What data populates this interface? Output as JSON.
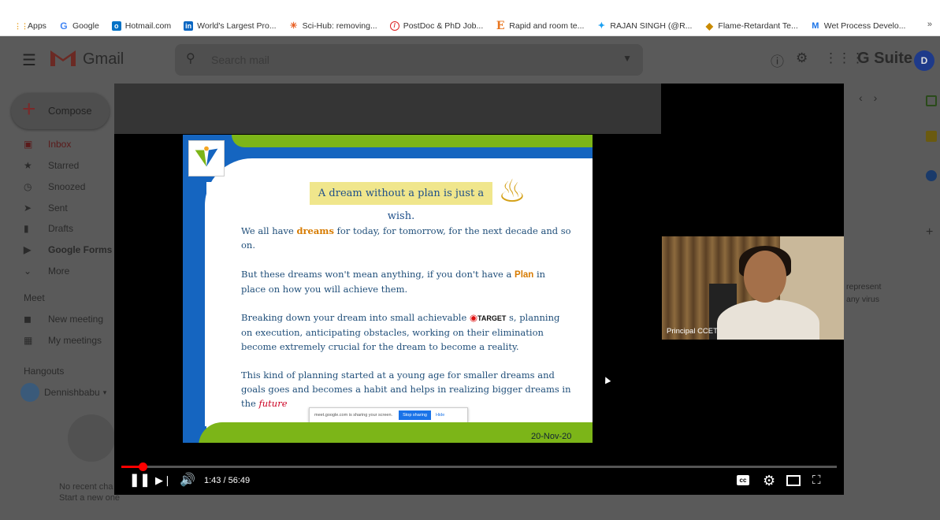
{
  "bookmarks": {
    "items": [
      {
        "label": "Apps",
        "icon": "apps-grid-icon",
        "color": "#e8a020"
      },
      {
        "label": "Google",
        "icon": "google-icon",
        "color": "#4285f4"
      },
      {
        "label": "Hotmail.com",
        "icon": "outlook-icon",
        "color": "#0072c6"
      },
      {
        "label": "World's Largest Pro...",
        "icon": "linkedin-icon",
        "color": "#0a66c2"
      },
      {
        "label": "Sci-Hub: removing...",
        "icon": "scihub-icon",
        "color": "#e85d20"
      },
      {
        "label": "PostDoc & PhD Job...",
        "icon": "compass-icon",
        "color": "#d22"
      },
      {
        "label": "Rapid and room te...",
        "icon": "elsevier-icon",
        "color": "#e87722"
      },
      {
        "label": "RAJAN SINGH (@R...",
        "icon": "twitter-icon",
        "color": "#1da1f2"
      },
      {
        "label": "Flame-Retardant Te...",
        "icon": "diamond-icon",
        "color": "#c98a00"
      },
      {
        "label": "Wet Process Develo...",
        "icon": "w-icon",
        "color": "#1a73e8"
      }
    ],
    "more": "»"
  },
  "gmail": {
    "logo_text": "Gmail",
    "search_placeholder": "Search mail",
    "brand": "G Suite",
    "avatar_letter": "D",
    "compose_label": "Compose",
    "nav": [
      {
        "label": "Inbox",
        "icon": "inbox-icon"
      },
      {
        "label": "Starred",
        "icon": "star-icon"
      },
      {
        "label": "Snoozed",
        "icon": "clock-icon"
      },
      {
        "label": "Sent",
        "icon": "send-icon"
      },
      {
        "label": "Drafts",
        "icon": "draft-icon"
      },
      {
        "label": "Google Forms",
        "icon": "label-icon"
      },
      {
        "label": "More",
        "icon": "chevron-down-icon"
      }
    ],
    "meet_title": "Meet",
    "meet_items": [
      {
        "label": "New meeting",
        "icon": "video-icon"
      },
      {
        "label": "My meetings",
        "icon": "calendar-icon"
      }
    ],
    "hangouts_title": "Hangouts",
    "hangouts_user": "Dennishbabu",
    "no_recent": "No recent cha",
    "start_new": "Start a new one",
    "bg_text_1": "represent",
    "bg_text_2": "any virus"
  },
  "slide": {
    "title": "A dream without a plan is just a wish.",
    "p1_a": "We all have ",
    "p1_dream": "dreams",
    "p1_b": " for today, for tomorrow, for the next decade and so on.",
    "p2_a": "But these dreams won't mean anything, if you don't have a ",
    "p2_plan": "Plan",
    "p2_b": " in place on how you will achieve them.",
    "p3_a": "Breaking down your dream into small achievable ",
    "p3_target": "TARGET",
    "p3_b": " s, planning on execution, anticipating obstacles, working on their elimination become extremely crucial for the dream to become a reality.",
    "p4_a": "This kind of planning started at a young age for smaller dreams and goals goes and becomes a habit and helps in realizing bigger dreams in the ",
    "p4_future": "future",
    "date": "20-Nov-20",
    "share_text": "meet.google.com is sharing your screen.",
    "share_stop": "Stop sharing",
    "share_hide": "Hide"
  },
  "webcam": {
    "name": "Principal CCET"
  },
  "player": {
    "time": "1:43 / 56:49",
    "progress": 0.03,
    "accent": "#ff0000"
  }
}
